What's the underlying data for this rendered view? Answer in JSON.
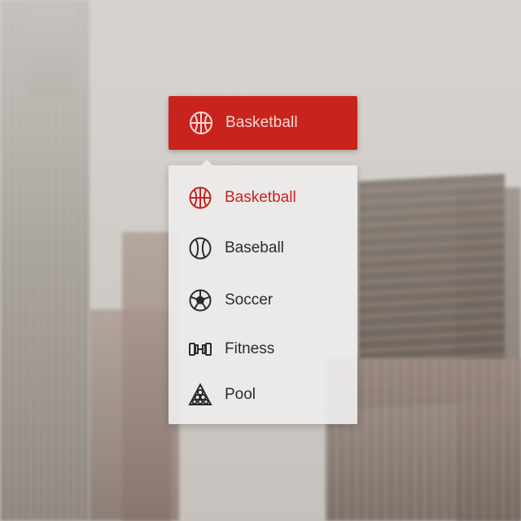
{
  "dropdown": {
    "selected": {
      "label": "Basketball",
      "icon": "basketball-icon"
    },
    "accent_color": "#c8241d",
    "options": [
      {
        "label": "Basketball",
        "icon": "basketball-icon",
        "selected": true
      },
      {
        "label": "Baseball",
        "icon": "baseball-icon",
        "selected": false
      },
      {
        "label": "Soccer",
        "icon": "soccer-ball-icon",
        "selected": false
      },
      {
        "label": "Fitness",
        "icon": "dumbbell-icon",
        "selected": false
      },
      {
        "label": "Pool",
        "icon": "pool-balls-icon",
        "selected": false
      }
    ]
  }
}
